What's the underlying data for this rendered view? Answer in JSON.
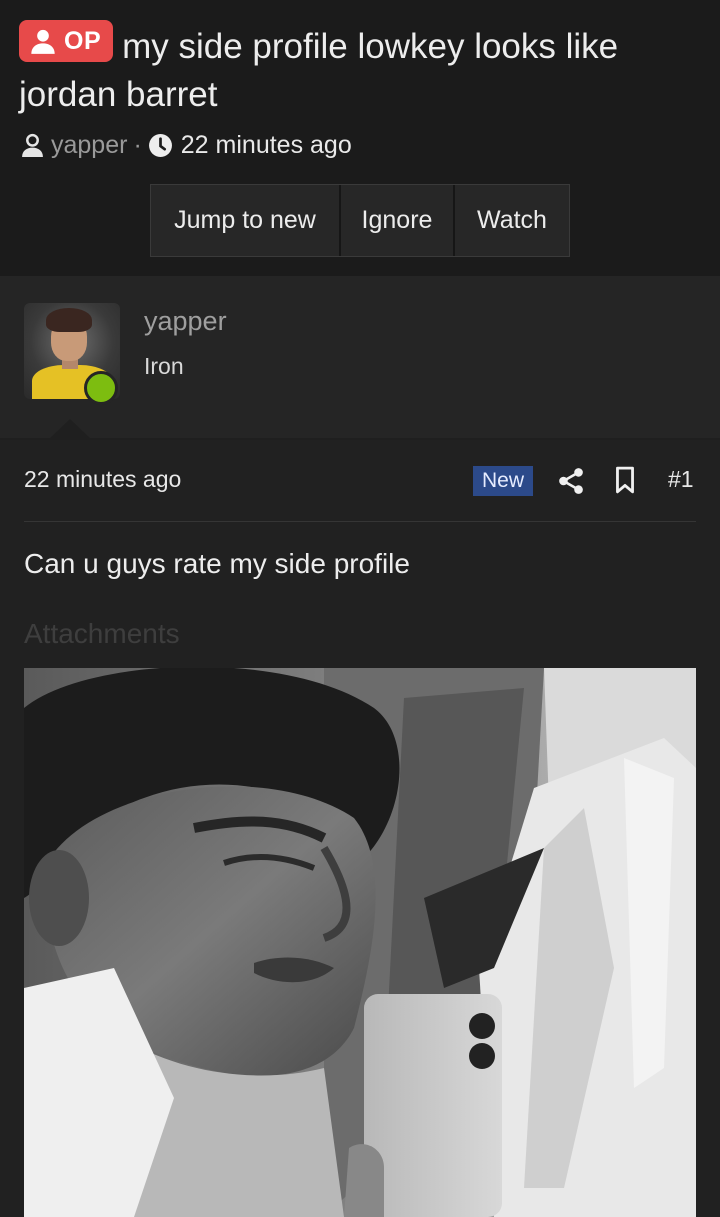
{
  "thread": {
    "op_badge": "OP",
    "title": "my side profile lowkey looks like jordan barret",
    "author": "yapper",
    "separator": "·",
    "time": "22 minutes ago"
  },
  "actions": {
    "jump_label": "Jump to new",
    "ignore_label": "Ignore",
    "watch_label": "Watch"
  },
  "user": {
    "name": "yapper",
    "rank": "Iron",
    "online_color": "#7dbd10"
  },
  "post": {
    "time": "22 minutes ago",
    "new_badge": "New",
    "number": "#1",
    "body": "Can u guys rate my side profile",
    "attachments_label": "Attachments"
  },
  "icons": [
    "user-icon",
    "clock-icon",
    "share-icon",
    "bookmark-icon"
  ],
  "colors": {
    "op_badge": "#e74a4a",
    "new_badge": "#2c4a8a",
    "background": "#1b1b1b"
  }
}
